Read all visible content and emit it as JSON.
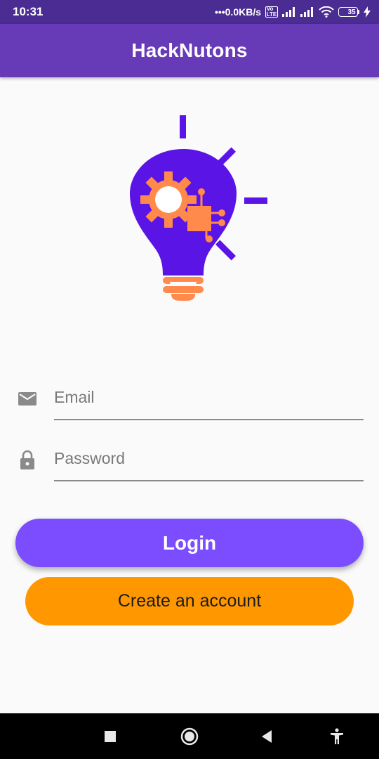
{
  "status_bar": {
    "time": "10:31",
    "network_speed": "•••0.0KB/s",
    "volte_label": "Vo LTE",
    "battery_level": "35"
  },
  "app_bar": {
    "title": "HackNutons"
  },
  "logo": {
    "icon": "lightbulb-gear-circuit-icon",
    "bulb_color": "#5b14e6",
    "accent_color": "#ff8a4c"
  },
  "form": {
    "email": {
      "placeholder": "Email",
      "value": "",
      "icon": "email-icon"
    },
    "password": {
      "placeholder": "Password",
      "value": "",
      "icon": "lock-icon"
    }
  },
  "buttons": {
    "login_label": "Login",
    "create_account_label": "Create an account",
    "login_color": "#7c4dff",
    "create_color": "#ff9800"
  },
  "nav_bar": {
    "items": [
      "recents-icon",
      "home-icon",
      "back-icon",
      "accessibility-icon"
    ]
  }
}
